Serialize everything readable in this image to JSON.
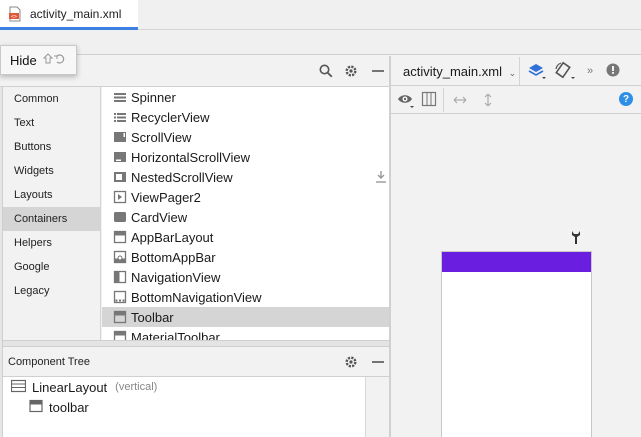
{
  "editor": {
    "tab_label": "activity_main.xml"
  },
  "tooltip": {
    "label": "Hide"
  },
  "palette": {
    "categories": [
      "Common",
      "Text",
      "Buttons",
      "Widgets",
      "Layouts",
      "Containers",
      "Helpers",
      "Google",
      "Legacy"
    ],
    "selected_category": "Containers",
    "widgets": [
      "Spinner",
      "RecyclerView",
      "ScrollView",
      "HorizontalScrollView",
      "NestedScrollView",
      "ViewPager2",
      "CardView",
      "AppBarLayout",
      "BottomAppBar",
      "NavigationView",
      "BottomNavigationView",
      "Toolbar",
      "MaterialToolbar"
    ],
    "selected_widget": "Toolbar"
  },
  "component_tree": {
    "title": "Component Tree",
    "root_label": "LinearLayout",
    "root_hint": "(vertical)",
    "child_label": "toolbar"
  },
  "design": {
    "file_select": "activity_main.xml",
    "help_label": "?",
    "toolbar_color": "#6a1ee0"
  },
  "colors": {
    "accent_blue": "#3d7fe3",
    "toolbar_purple": "#6a1ee0",
    "selected_gray": "#d5d5d5"
  }
}
